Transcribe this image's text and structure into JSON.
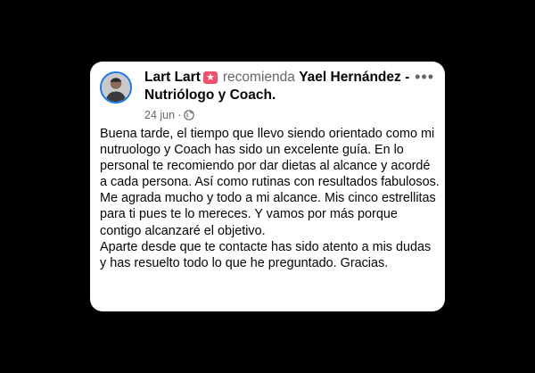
{
  "post": {
    "author": "Lart Lart",
    "badge_icon": "star-icon",
    "verb": "recomienda",
    "target": "Yael Hernández - Nutriólogo y Coach.",
    "date": "24 jun",
    "separator": "·",
    "audience_icon": "globe-icon",
    "more_icon": "more-options-icon",
    "paragraphs": [
      "Buena tarde, el tiempo que llevo siendo orientado como mi nutruologo y Coach has sido un excelente guía. En lo personal te recomiendo por dar dietas al alcance y acordé a cada persona. Así como rutinas con resultados fabulosos. Me agrada mucho y todo a mi alcance. Mis cinco estrellitas para ti pues te lo mereces. Y vamos por más porque contigo alcanzaré el objetivo.",
      "Aparte desde que te contacte has sido atento a mis dudas y has resuelto todo lo que he preguntado. Gracias."
    ],
    "colors": {
      "background": "#000000",
      "card": "#ffffff",
      "text": "#050505",
      "secondary_text": "#65676b",
      "badge": "#f0506e",
      "avatar_ring": "#1877f2"
    }
  }
}
